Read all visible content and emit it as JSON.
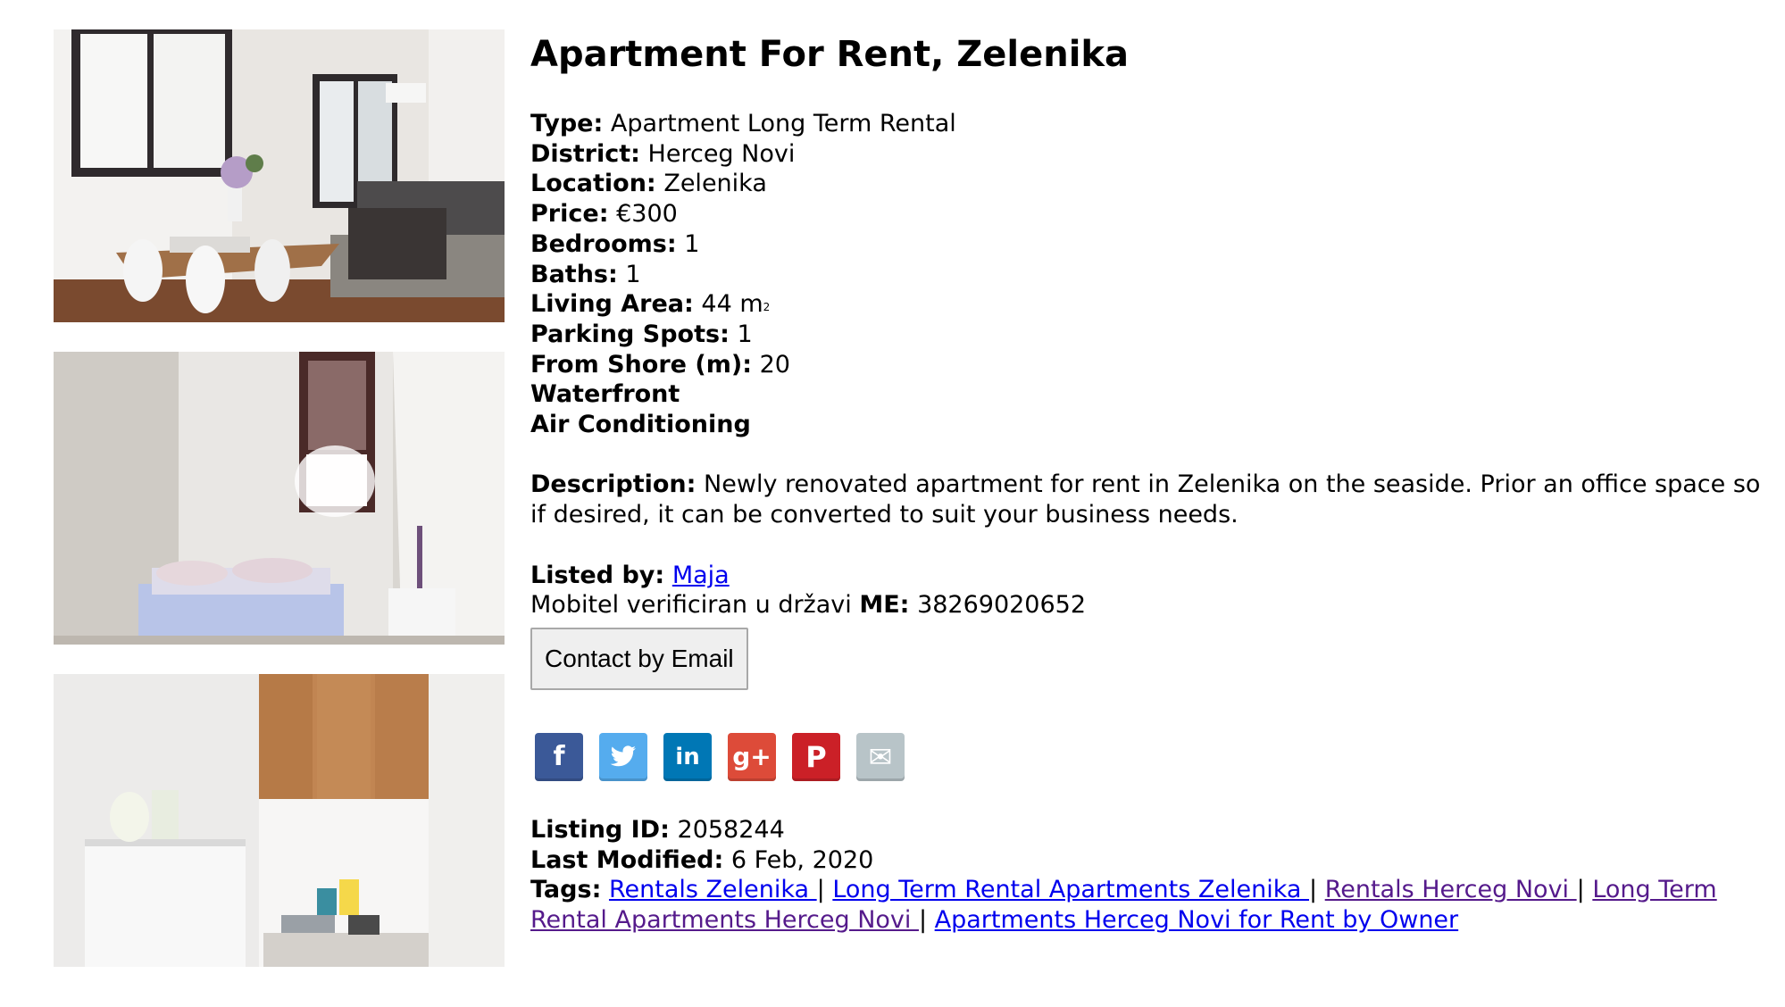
{
  "listing": {
    "title": "Apartment For Rent, Zelenika",
    "fields": [
      {
        "label": "Type",
        "value": "Apartment Long Term Rental"
      },
      {
        "label": "District",
        "value": "Herceg Novi"
      },
      {
        "label": "Location",
        "value": "Zelenika"
      },
      {
        "label": "Price",
        "value": "€300"
      },
      {
        "label": "Bedrooms",
        "value": "1"
      },
      {
        "label": "Baths",
        "value": "1"
      },
      {
        "label": "Living Area",
        "value": "44 m",
        "unit_sup": "2"
      },
      {
        "label": "Parking Spots",
        "value": "1"
      },
      {
        "label": "From Shore (m)",
        "value": "20"
      }
    ],
    "features": [
      "Waterfront",
      "Air Conditioning"
    ],
    "description_label": "Description",
    "description": "Newly renovated apartment for rent in Zelenika on the seaside. Prior an office space so if desired, it can be converted to suit your business needs.",
    "listed_by_label": "Listed by",
    "listed_by": "Maja",
    "phone_prefix": "Mobitel verificiran u državi ",
    "phone_country": "ME",
    "phone_number": "38269020652",
    "contact_button": "Contact by Email",
    "share": [
      {
        "icon": "facebook-icon",
        "glyph": "f",
        "color": "#3b5998"
      },
      {
        "icon": "twitter-icon",
        "glyph": "🐦",
        "color": "#55acee"
      },
      {
        "icon": "linkedin-icon",
        "glyph": "in",
        "color": "#0077b5"
      },
      {
        "icon": "google-plus-icon",
        "glyph": "g+",
        "color": "#dd4b39"
      },
      {
        "icon": "pinterest-icon",
        "glyph": "P",
        "color": "#cb2027"
      },
      {
        "icon": "email-icon",
        "glyph": "✉",
        "color": "#b8c4c8"
      }
    ],
    "listing_id_label": "Listing ID",
    "listing_id": "2058244",
    "last_modified_label": "Last Modified",
    "last_modified": "6 Feb, 2020",
    "tags_label": "Tags",
    "tags": [
      {
        "text": "Rentals Zelenika ",
        "visited": false
      },
      {
        "text": "Long Term Rental Apartments Zelenika ",
        "visited": false
      },
      {
        "text": "Rentals Herceg Novi ",
        "visited": true
      },
      {
        "text": "Long Term Rental Apartments Herceg Novi ",
        "visited": true
      },
      {
        "text": "Apartments Herceg Novi for Rent by Owner",
        "visited": false
      }
    ]
  },
  "colors": {
    "link": "#0000ee",
    "visited_link": "#551a8b"
  }
}
